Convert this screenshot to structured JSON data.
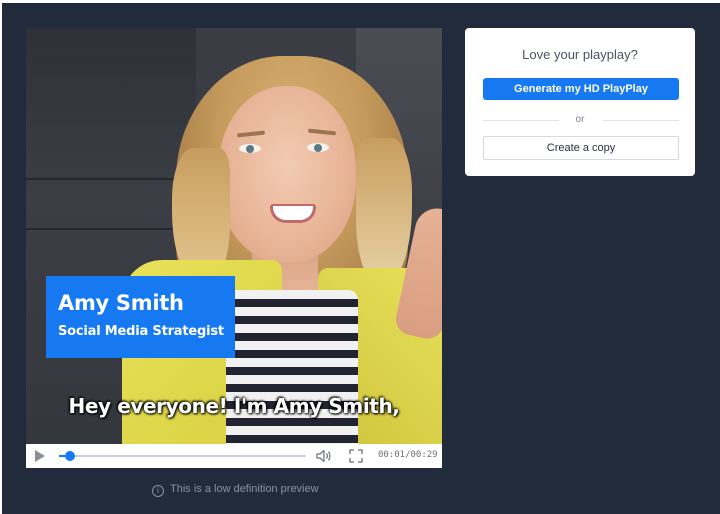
{
  "video": {
    "lower_third": {
      "name": "Amy Smith",
      "role": "Social Media Strategist",
      "background_color": "#1779f2"
    },
    "subtitle": "Hey everyone! I'm Amy Smith,",
    "controls": {
      "current_time": "00:01",
      "duration": "00:29",
      "time_display": "00:01/00:29",
      "progress_fraction": 0.045,
      "play_icon": "play-icon",
      "volume_icon": "volume-icon",
      "fullscreen_icon": "fullscreen-icon"
    },
    "preview_note": "This is a low definition preview"
  },
  "card": {
    "title": "Love your playplay?",
    "primary_button": "Generate my HD PlayPlay",
    "separator": "or",
    "secondary_button": "Create a copy"
  },
  "colors": {
    "background": "#222b3b",
    "accent": "#1779f2",
    "card": "#ffffff"
  }
}
